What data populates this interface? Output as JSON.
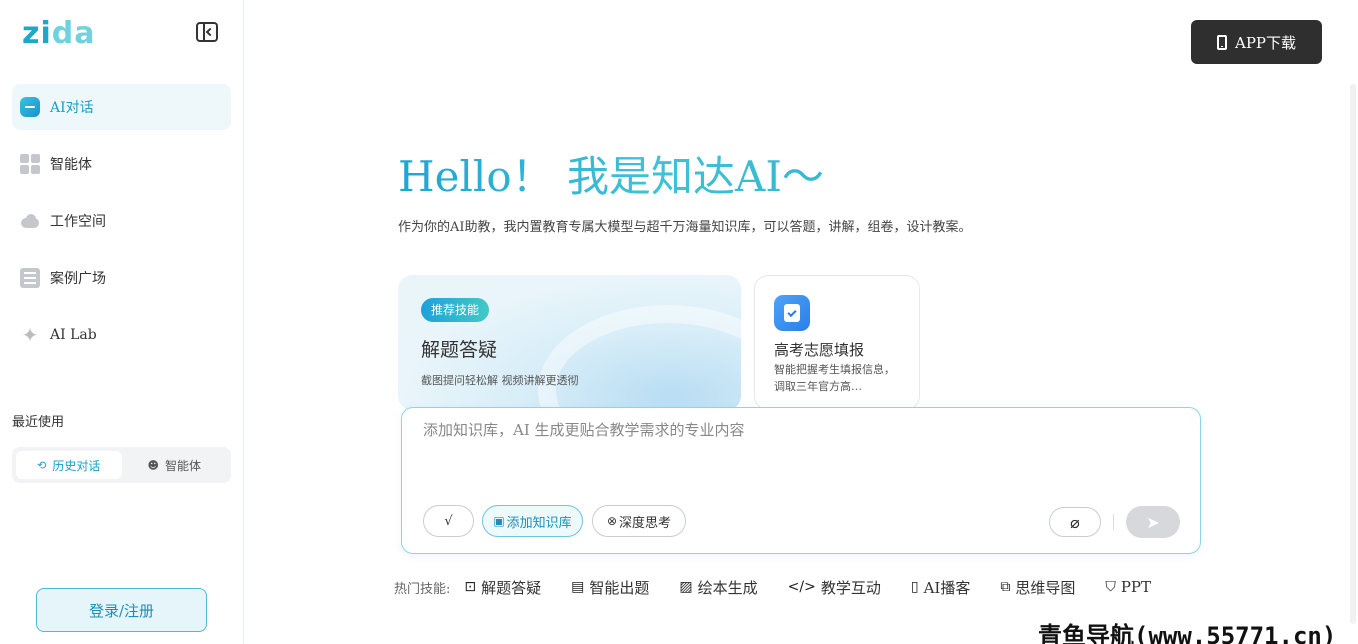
{
  "brand": {
    "logo_text_a": "zi",
    "logo_text_b": "da"
  },
  "sidebar": {
    "items": [
      {
        "label": "AI对话",
        "icon": "chat-icon"
      },
      {
        "label": "智能体",
        "icon": "grid-icon"
      },
      {
        "label": "工作空间",
        "icon": "cloud-icon"
      },
      {
        "label": "案例广场",
        "icon": "list-icon"
      },
      {
        "label": "AI Lab",
        "icon": "sparkle-icon"
      }
    ],
    "recent_title": "最近使用",
    "recent_tabs": [
      {
        "label": "历史对话",
        "icon": "history-icon",
        "active": true
      },
      {
        "label": "智能体",
        "icon": "robot-icon",
        "active": false
      }
    ],
    "login_label": "登录/注册"
  },
  "header": {
    "app_download_label": "APP下载"
  },
  "main": {
    "greeting": "Hello！  我是知达AI～",
    "subtitle": "作为你的AI助教，我内置教育专属大模型与超千万海量知识库，可以答题，讲解，组卷，设计教案。",
    "featured_card": {
      "badge": "推荐技能",
      "title": "解题答疑",
      "desc": "截图提问轻松解 视频讲解更透彻"
    },
    "side_card": {
      "title": "高考志愿填报",
      "desc": "智能把握考生填报信息，调取三年官方高…"
    },
    "input": {
      "placeholder": "添加知识库，AI 生成更贴合教学需求的专业内容",
      "formula_label": "√",
      "kb_label": "添加知识库",
      "deep_label": "深度思考"
    },
    "hot": {
      "label": "热门技能:",
      "items": [
        {
          "label": "解题答疑",
          "icon": "image-question-icon"
        },
        {
          "label": "智能出题",
          "icon": "document-icon"
        },
        {
          "label": "绘本生成",
          "icon": "picture-icon"
        },
        {
          "label": "教学互动",
          "icon": "code-icon"
        },
        {
          "label": "AI播客",
          "icon": "microphone-icon"
        },
        {
          "label": "思维导图",
          "icon": "mindmap-icon"
        },
        {
          "label": "PPT",
          "icon": "presentation-icon"
        }
      ]
    }
  },
  "watermark": "青鱼导航(www.55771.cn)",
  "colors": {
    "accent": "#1b9ec4",
    "dark_button": "#2f2f2f",
    "border_accent": "#8fd4e6"
  }
}
